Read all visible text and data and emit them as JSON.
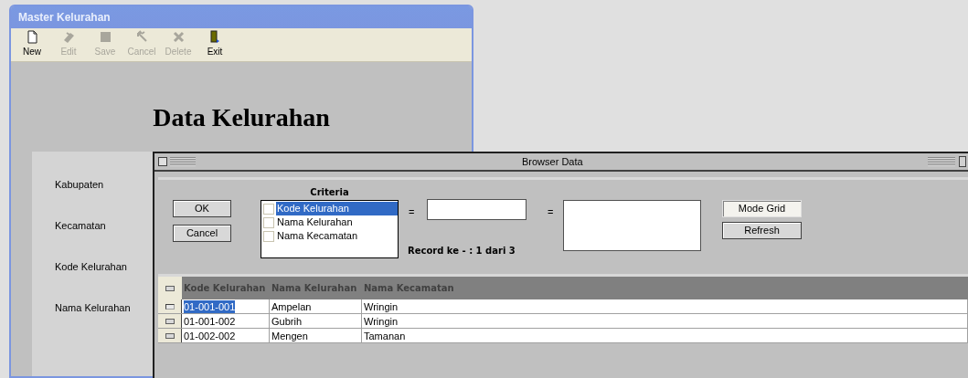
{
  "master_window": {
    "title": "Master Kelurahan",
    "toolbar": [
      {
        "label": "New",
        "kind": "new",
        "disabled": false
      },
      {
        "label": "Edit",
        "kind": "edit",
        "disabled": true
      },
      {
        "label": "Save",
        "kind": "save",
        "disabled": true
      },
      {
        "label": "Cancel",
        "kind": "cancel",
        "disabled": true
      },
      {
        "label": "Delete",
        "kind": "delete",
        "disabled": true
      },
      {
        "label": "Exit",
        "kind": "exit",
        "disabled": false
      }
    ],
    "heading": "Data Kelurahan",
    "form_labels": [
      "Kabupaten",
      "Kecamatan",
      "Kode Kelurahan",
      "Nama Kelurahan"
    ]
  },
  "browser_window": {
    "title": "Browser Data",
    "buttons": [
      "OK",
      "Cancel"
    ],
    "criteria_title": "Criteria",
    "criteria": [
      {
        "label": "Kode Kelurahan",
        "checked": false,
        "selected": true
      },
      {
        "label": "Nama Kelurahan",
        "checked": false,
        "selected": false
      },
      {
        "label": "Nama Kecamatan",
        "checked": false,
        "selected": false
      }
    ],
    "equals": [
      "=",
      "="
    ],
    "record_info": "Record ke - : 1 dari 3",
    "mode_buttons": [
      {
        "label": "Mode Grid",
        "pressed": true
      },
      {
        "label": "Refresh",
        "pressed": false
      }
    ],
    "table": {
      "columns": [
        "Kode Kelurahan",
        "Nama Kelurahan",
        "Nama Kecamatan"
      ],
      "rows": [
        {
          "cells": [
            "01-001-001",
            "Ampelan",
            "Wringin"
          ],
          "selected": true
        },
        {
          "cells": [
            "01-001-002",
            "Gubrih",
            "Wringin"
          ],
          "selected": false
        },
        {
          "cells": [
            "01-002-002",
            "Mengen",
            "Tamanan"
          ],
          "selected": false
        }
      ]
    }
  }
}
